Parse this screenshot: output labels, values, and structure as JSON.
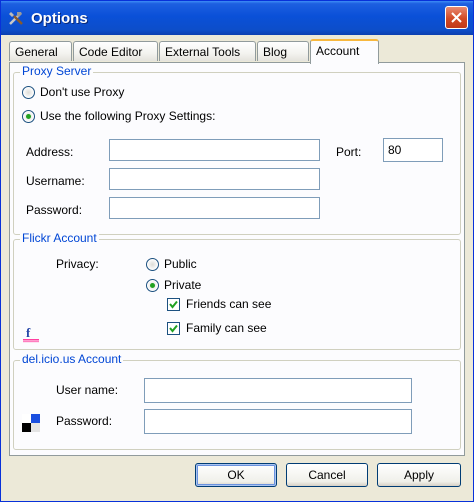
{
  "window": {
    "title": "Options"
  },
  "tabs": [
    "General",
    "Code Editor",
    "External Tools",
    "Blog",
    "Account"
  ],
  "active_tab": "Account",
  "proxy": {
    "legend": "Proxy Server",
    "option_none": "Don't use Proxy",
    "option_custom": "Use the following Proxy Settings:",
    "selected": "custom",
    "address_label": "Address:",
    "address_value": "",
    "port_label": "Port:",
    "port_value": "80",
    "username_label": "Username:",
    "username_value": "",
    "password_label": "Password:",
    "password_value": ""
  },
  "flickr": {
    "legend": "Flickr Account",
    "privacy_label": "Privacy:",
    "public_label": "Public",
    "private_label": "Private",
    "selected": "private",
    "friends_label": "Friends can see",
    "friends_checked": true,
    "family_label": "Family can see",
    "family_checked": true,
    "logo_icon": "flickr-logo-icon"
  },
  "delicious": {
    "legend": "del.icio.us Account",
    "username_label": "User name:",
    "username_value": "",
    "password_label": "Password:",
    "password_value": "",
    "logo_icon": "delicious-logo-icon"
  },
  "buttons": {
    "ok": "OK",
    "cancel": "Cancel",
    "apply": "Apply"
  },
  "colors": {
    "titlebar": "#0a50d8",
    "legend": "#0046d5",
    "check": "#21a121",
    "tab_highlight": "#f8b83e"
  }
}
